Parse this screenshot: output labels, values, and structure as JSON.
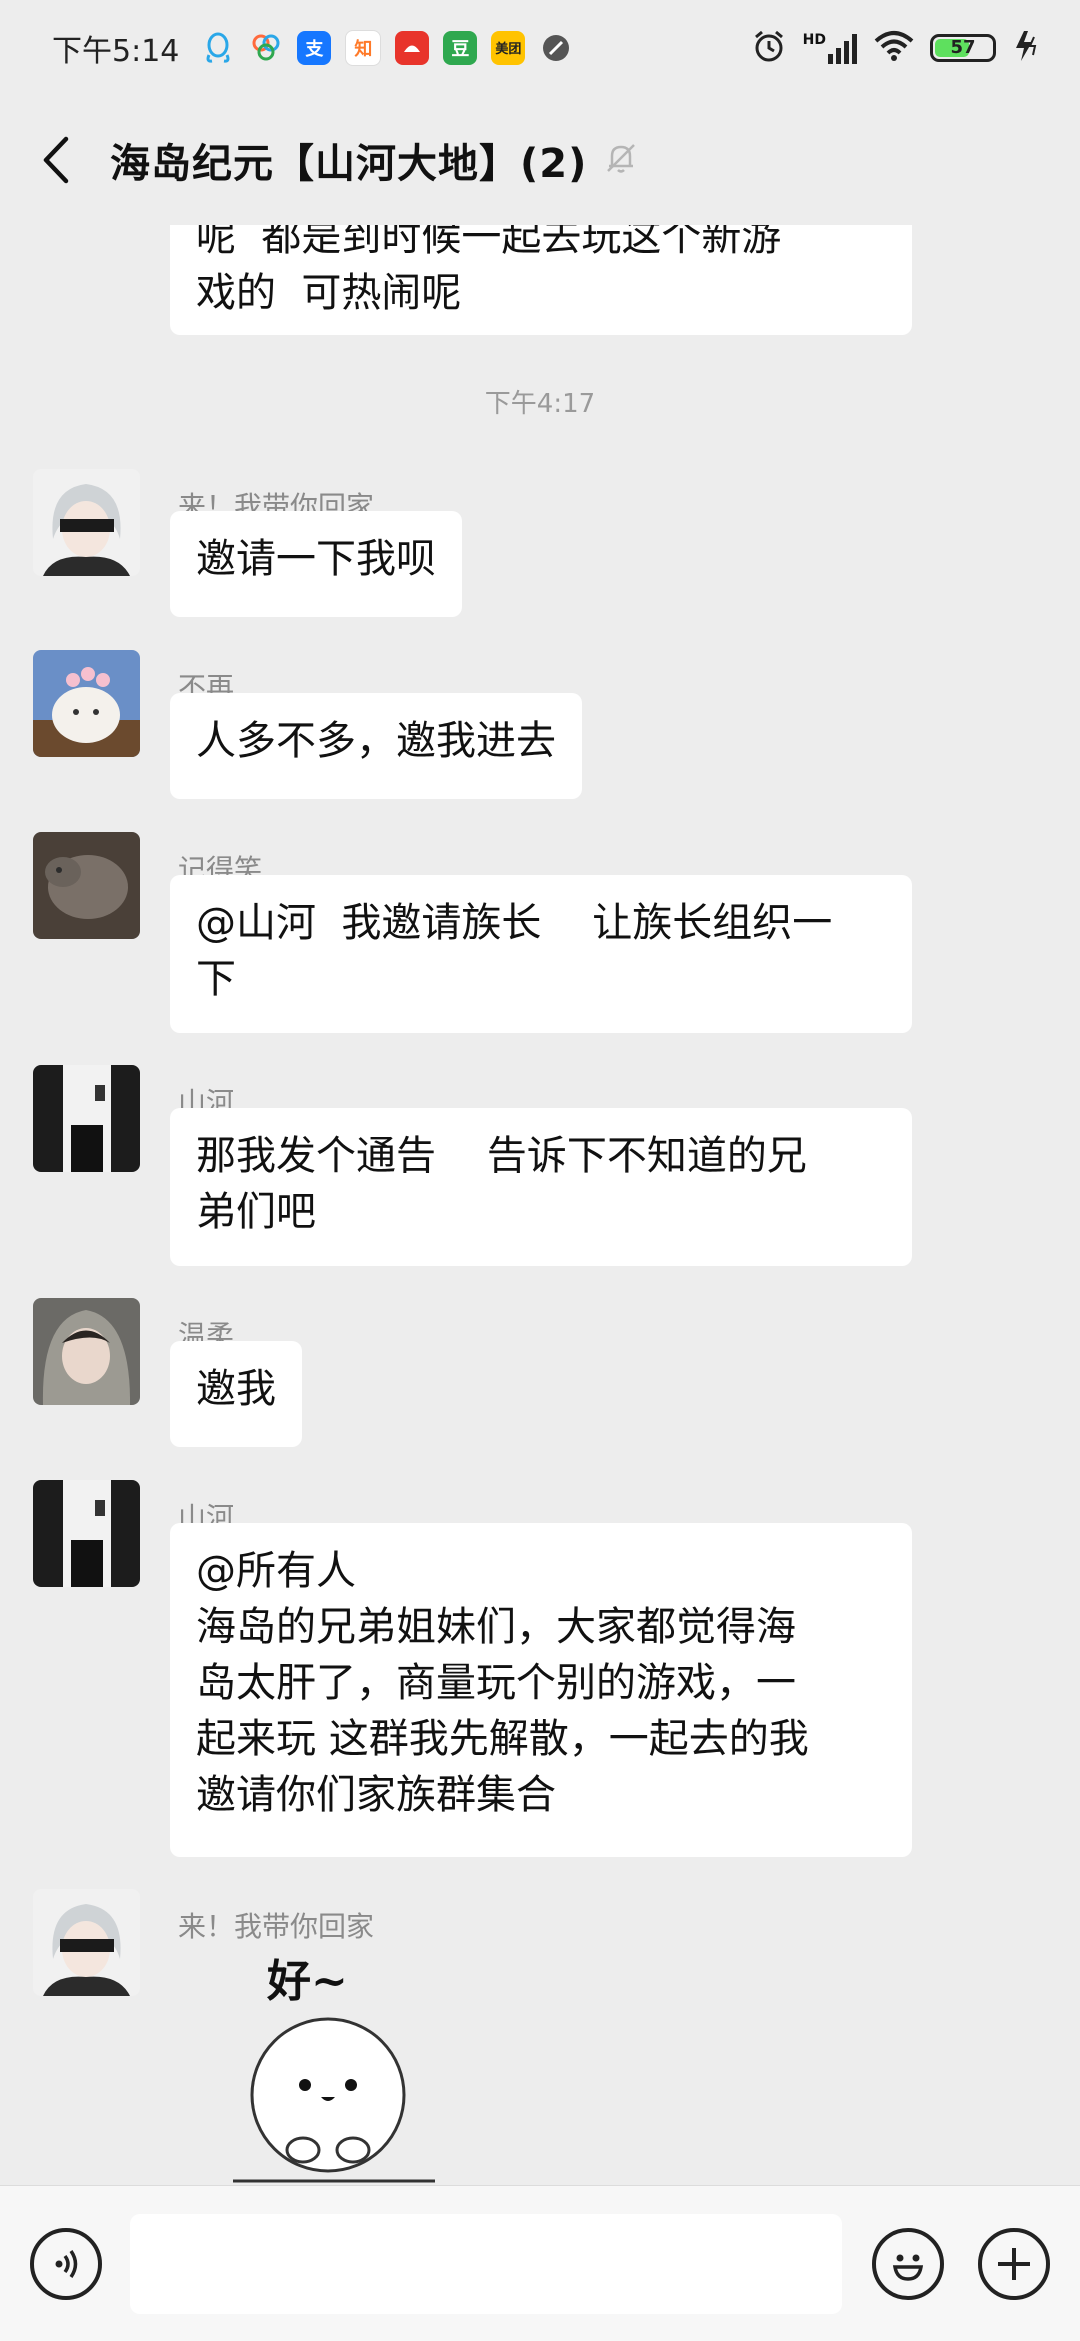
{
  "status_bar": {
    "time": "下午5:14",
    "battery": "57",
    "network": "HD",
    "apps": [
      {
        "name": "qq-icon",
        "glyph": "",
        "color": "#2aa7e8"
      },
      {
        "name": "pinwheel-icon",
        "glyph": "",
        "color": "#ff6a3d"
      },
      {
        "name": "alipay-icon",
        "glyph": "支",
        "color": "#1677ff"
      },
      {
        "name": "zhihu-icon",
        "glyph": "知",
        "color": "#ff7a29"
      },
      {
        "name": "red-app-icon",
        "glyph": "",
        "color": "#e8342b"
      },
      {
        "name": "douban-icon",
        "glyph": "豆",
        "color": "#2fa84f"
      },
      {
        "name": "meituan-icon",
        "glyph": "美团",
        "color": "#ffc300"
      },
      {
        "name": "blocked-icon",
        "glyph": "",
        "color": "#555555"
      }
    ]
  },
  "header": {
    "title": "海岛纪元【山河大地】(2)"
  },
  "chat": {
    "partial_message": "呢  都是到时候一起去玩这个新游\n戏的  可热闹呢",
    "timestamp": "下午4:17",
    "messages": [
      {
        "sender": "来！我带你回家",
        "text": "邀请一下我呗"
      },
      {
        "sender": "不再",
        "text": "人多不多，邀我进去"
      },
      {
        "sender": "记得笑",
        "text": "@山河  我邀请族长    让族长组织一\n下"
      },
      {
        "sender": "山河",
        "text": "那我发个通告    告诉下不知道的兄\n弟们吧"
      },
      {
        "sender": "温柔",
        "text": "邀我"
      },
      {
        "sender": "山河",
        "text": "@所有人\n海岛的兄弟姐妹们，大家都觉得海\n岛太肝了，商量玩个别的游戏，一\n起来玩 这群我先解散，一起去的我\n邀请你们家族群集合"
      },
      {
        "sender": "来！我带你回家",
        "sticker_text": "好~"
      }
    ]
  },
  "input": {
    "value": "",
    "placeholder": ""
  }
}
